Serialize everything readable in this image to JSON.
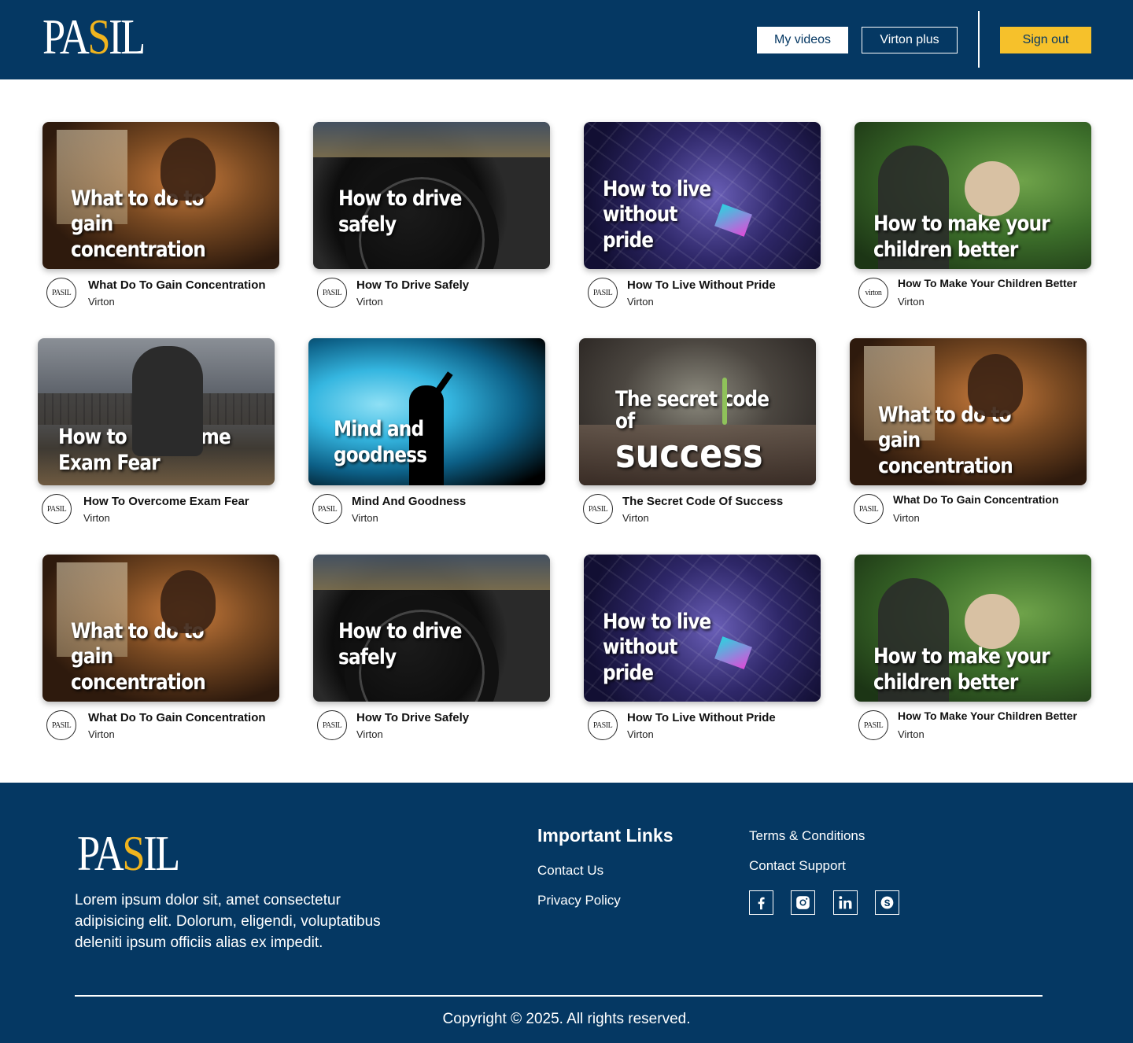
{
  "header": {
    "logo": {
      "pre": "PA",
      "s": "S",
      "post": "IL"
    },
    "my_videos": "My videos",
    "virton_plus": "Virton plus",
    "sign_out": "Sign out"
  },
  "colors": {
    "brand_navy": "#053863",
    "accent_yellow": "#f6c12b",
    "logo_s": "#f0b41e"
  },
  "cards": [
    {
      "thumb_text": "What to do to gain concentration",
      "title": "What Do To Gain Concentration",
      "channel": "Virton",
      "avatar": "PASIL"
    },
    {
      "thumb_text": "How to drive safely",
      "title": "How To Drive Safely",
      "channel": "Virton",
      "avatar": "PASIL"
    },
    {
      "thumb_text": "How to live without pride",
      "title": "How To Live Without Pride",
      "channel": "Virton",
      "avatar": "PASIL"
    },
    {
      "thumb_text": "How to make your children better",
      "title": "How To Make Your Children Better",
      "channel": "Virton",
      "avatar": "virton"
    },
    {
      "thumb_text": "How to Overcome Exam Fear",
      "title": "How To Overcome Exam Fear",
      "channel": "Virton",
      "avatar": "PASIL"
    },
    {
      "thumb_text": "Mind and goodness",
      "title": "Mind And Goodness",
      "channel": "Virton",
      "avatar": "PASIL"
    },
    {
      "thumb_text_small": "The secret code of",
      "thumb_text_big": "success",
      "title": "The Secret Code Of Success",
      "channel": "Virton",
      "avatar": "PASIL"
    },
    {
      "thumb_text": "What to do to gain concentration",
      "title": "What Do To Gain Concentration",
      "channel": "Virton",
      "avatar": "PASIL"
    },
    {
      "thumb_text": "What to do to gain concentration",
      "title": "What Do To Gain Concentration",
      "channel": "Virton",
      "avatar": "PASIL"
    },
    {
      "thumb_text": "How to drive safely",
      "title": "How To Drive Safely",
      "channel": "Virton",
      "avatar": "PASIL"
    },
    {
      "thumb_text": "How to live without pride",
      "title": "How To Live Without Pride",
      "channel": "Virton",
      "avatar": "PASIL"
    },
    {
      "thumb_text": "How to make your children better",
      "title": "How To Make Your Children Better",
      "channel": "Virton",
      "avatar": "PASIL"
    }
  ],
  "footer": {
    "logo": {
      "pre": "PA",
      "s": "S",
      "post": "IL"
    },
    "description": "Lorem ipsum dolor sit, amet consectetur adipisicing elit. Dolorum, eligendi, voluptatibus deleniti ipsum officiis alias ex impedit.",
    "heading": "Important Links",
    "contact_us": "Contact Us",
    "privacy_policy": "Privacy Policy",
    "terms": "Terms & Conditions",
    "contact_support": "Contact Support",
    "social_icons": [
      "facebook-icon",
      "instagram-icon",
      "linkedin-icon",
      "skype-icon"
    ],
    "copyright": "Copyright © 2025. All rights reserved."
  }
}
